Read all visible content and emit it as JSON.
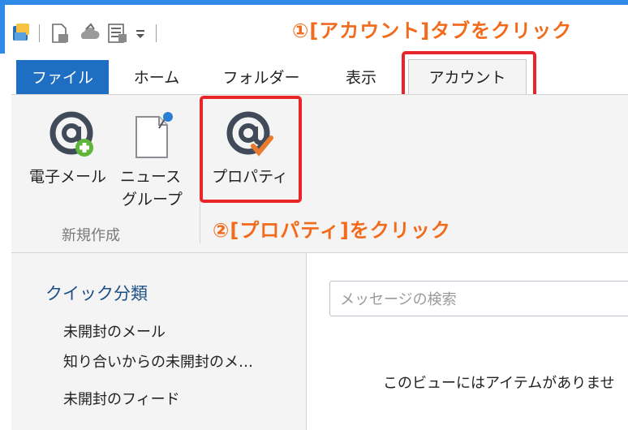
{
  "annotations": {
    "step1": "①[アカウント]タブをクリック",
    "step2": "②[プロパティ]をクリック"
  },
  "quick_access": {
    "icons": [
      "app-icon",
      "new-doc-icon",
      "cloud-send-icon",
      "properties-sheet-icon",
      "dropdown-arrow-icon"
    ]
  },
  "tabs": {
    "file": "ファイル",
    "home": "ホーム",
    "folder": "フォルダー",
    "view": "表示",
    "account": "アカウント"
  },
  "ribbon": {
    "email": "電子メール",
    "news_line1": "ニュース",
    "news_line2": "グループ",
    "properties": "プロパティ",
    "group_label": "新規作成"
  },
  "nav": {
    "heading": "クイック分類",
    "items": [
      "未開封のメール",
      "知り合いからの未開封のメ…",
      "未開封のフィード"
    ]
  },
  "search": {
    "placeholder": "メッセージの検索"
  },
  "main": {
    "empty_message": "このビューにはアイテムがありませ"
  },
  "colors": {
    "accent_blue": "#1e6fc4",
    "annotation_orange": "#f26b1d",
    "highlight_red": "#e8262a",
    "green_plus": "#5fb53a"
  }
}
